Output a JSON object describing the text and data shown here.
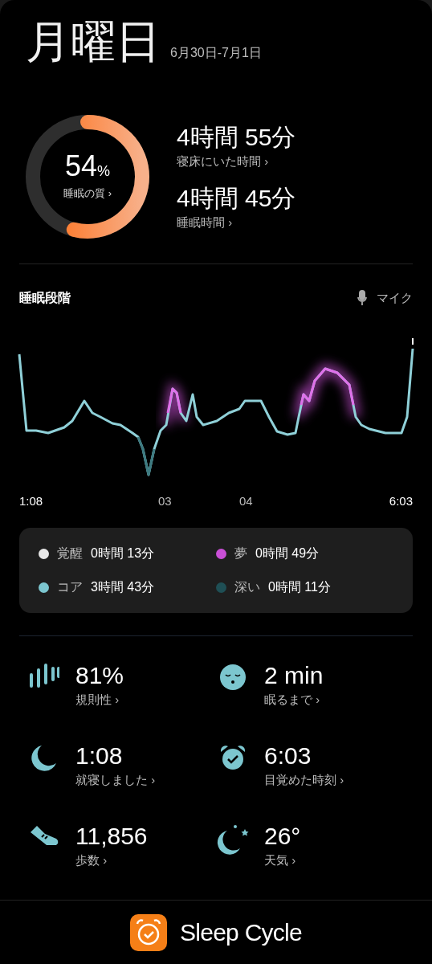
{
  "header": {
    "title": "月曜日",
    "date_range": "6月30日-7月1日"
  },
  "quality": {
    "value": "54",
    "unit": "%",
    "label": "睡眠の質",
    "chevron": "›"
  },
  "summary": [
    {
      "value": "4時間 55分",
      "label": "寝床にいた時間",
      "chevron": "›"
    },
    {
      "value": "4時間 45分",
      "label": "睡眠時間",
      "chevron": "›"
    }
  ],
  "sleep_stages": {
    "title": "睡眠段階",
    "mic_label": "マイク",
    "time_labels": [
      "1:08",
      "03",
      "04",
      "6:03"
    ]
  },
  "legend": [
    {
      "name": "覚醒",
      "duration": "0時間 13分",
      "color": "#e8e8e8"
    },
    {
      "name": "夢",
      "duration": "0時間 49分",
      "color": "#c94fd6"
    },
    {
      "name": "コア",
      "duration": "3時間 43分",
      "color": "#7cc6cf"
    },
    {
      "name": "深い",
      "duration": "0時間 11分",
      "color": "#1f4f55"
    }
  ],
  "stats": [
    {
      "kind": "regularity",
      "value": "81%",
      "label": "規則性",
      "chevron": "›"
    },
    {
      "kind": "fall_asleep",
      "value": "2 min",
      "label": "眠るまで",
      "chevron": "›"
    },
    {
      "kind": "bedtime",
      "value": "1:08",
      "label": "就寝しました",
      "chevron": "›"
    },
    {
      "kind": "wake",
      "value": "6:03",
      "label": "目覚めた時刻",
      "chevron": "›"
    },
    {
      "kind": "steps",
      "value": "11,856",
      "label": "歩数",
      "chevron": "›"
    },
    {
      "kind": "weather",
      "value": "26°",
      "label": "天気",
      "chevron": "›"
    }
  ],
  "footer": {
    "app_name": "Sleep Cycle"
  }
}
